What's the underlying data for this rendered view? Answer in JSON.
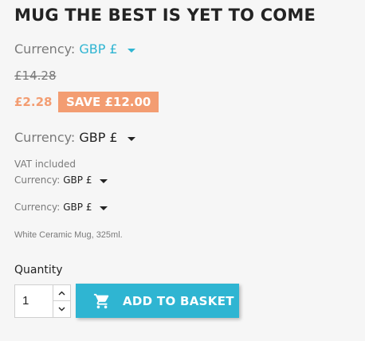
{
  "product": {
    "title": "MUG THE BEST IS YET TO COME",
    "regular_price": "£14.28",
    "price": "£2.28",
    "discount_badge": "SAVE £12.00",
    "tax_note": "VAT included",
    "description": "White Ceramic Mug, 325ml."
  },
  "currency_selectors": [
    {
      "label": "Currency:",
      "value": "GBP £"
    },
    {
      "label": "Currency:",
      "value": "GBP £"
    },
    {
      "label": "Currency:",
      "value": "GBP £"
    },
    {
      "label": "Currency:",
      "value": "GBP £"
    }
  ],
  "add_to_cart": {
    "quantity_label": "Quantity",
    "quantity_value": "1",
    "button_label": "ADD TO BASKET",
    "icon": "shopping-cart-icon"
  },
  "colors": {
    "accent": "#2fb5d2",
    "discount": "#f39d72",
    "heading": "#232323",
    "text": "#7a7a7a",
    "background": "#f6f6f6"
  }
}
